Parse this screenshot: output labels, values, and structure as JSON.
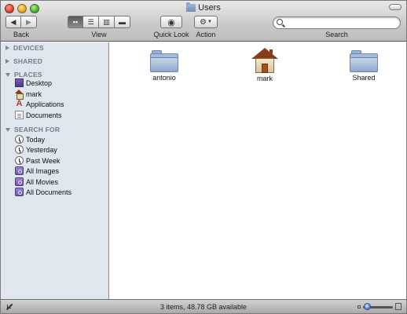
{
  "window": {
    "title": "Users"
  },
  "toolbar": {
    "back_label": "Back",
    "view_label": "View",
    "quicklook_label": "Quick Look",
    "action_label": "Action",
    "search_label": "Search",
    "search_placeholder": "",
    "view_modes": [
      "icon",
      "list",
      "column",
      "coverflow"
    ],
    "active_view": "icon"
  },
  "sidebar": {
    "devices": {
      "header": "DEVICES",
      "expanded": false
    },
    "shared": {
      "header": "SHARED",
      "expanded": false
    },
    "places": {
      "header": "PLACES",
      "items": [
        {
          "label": "Desktop",
          "icon": "desktop-icon"
        },
        {
          "label": "mark",
          "icon": "home-icon"
        },
        {
          "label": "Applications",
          "icon": "applications-icon"
        },
        {
          "label": "Documents",
          "icon": "documents-icon"
        }
      ]
    },
    "search_for": {
      "header": "SEARCH FOR",
      "items": [
        {
          "label": "Today",
          "icon": "clock-icon"
        },
        {
          "label": "Yesterday",
          "icon": "clock-icon"
        },
        {
          "label": "Past Week",
          "icon": "clock-icon"
        },
        {
          "label": "All Images",
          "icon": "smart-folder-icon"
        },
        {
          "label": "All Movies",
          "icon": "smart-folder-icon"
        },
        {
          "label": "All Documents",
          "icon": "smart-folder-icon"
        }
      ]
    }
  },
  "content": {
    "items": [
      {
        "label": "antonio",
        "icon": "folder-icon"
      },
      {
        "label": "mark",
        "icon": "home-folder-icon"
      },
      {
        "label": "Shared",
        "icon": "folder-icon"
      }
    ]
  },
  "status": {
    "text": "3 items, 48.78 GB available"
  },
  "colors": {
    "sidebar_bg": "#dfe6ee",
    "section_header": "#6f7c8c",
    "slider_thumb": "#4d79c7"
  }
}
